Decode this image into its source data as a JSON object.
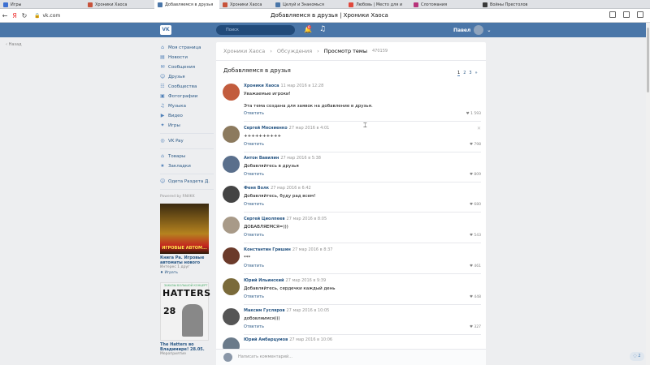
{
  "browser": {
    "tabs": [
      {
        "label": "Игры",
        "color": "#3c6fd1"
      },
      {
        "label": "Хроники Хаоса",
        "color": "#c7533b"
      },
      {
        "label": "Добавляемся в друзья",
        "color": "#4a76a8",
        "active": true
      },
      {
        "label": "Хроники Хаоса",
        "color": "#c7533b"
      },
      {
        "label": "Целуй и Знакомься",
        "color": "#4a76a8"
      },
      {
        "label": "Любовь | Место для и",
        "color": "#e0483c"
      },
      {
        "label": "Слотомания",
        "color": "#b7337a"
      },
      {
        "label": "Войны Престолов",
        "color": "#3a3a3a"
      }
    ],
    "url": "vk.com",
    "page_title": "Добавляемся в друзья | Хроники Хаоса"
  },
  "header": {
    "search_placeholder": "Поиск",
    "notif_count": "6",
    "user_name": "Павел"
  },
  "back_label": "Назад",
  "nav": {
    "items": [
      {
        "label": "Моя страница",
        "icon": "⌂"
      },
      {
        "label": "Новости",
        "icon": "▤"
      },
      {
        "label": "Сообщения",
        "icon": "✉"
      },
      {
        "label": "Друзья",
        "icon": "☺"
      },
      {
        "label": "Сообщества",
        "icon": "☷"
      },
      {
        "label": "Фотографии",
        "icon": "▣"
      },
      {
        "label": "Музыка",
        "icon": "♫"
      },
      {
        "label": "Видео",
        "icon": "▶"
      },
      {
        "label": "Игры",
        "icon": "✦"
      }
    ],
    "items2": [
      {
        "label": "VK Pay",
        "icon": "◎"
      }
    ],
    "items3": [
      {
        "label": "Товары",
        "icon": "⌂"
      },
      {
        "label": "Закладки",
        "icon": "★"
      }
    ],
    "items4": [
      {
        "label": "Одета Раздета Д.",
        "icon": "☺"
      }
    ]
  },
  "ads": {
    "powered": "Powered by RNIIKK",
    "ad1_img_text": "ИГРОВЫЕ АВТОМ...",
    "ad1_title": "Книга Ра. Игровые автоматы нового",
    "ad1_sub": "Интерес 1 друг",
    "ad1_link": "♦ Играть",
    "ad2_top": "ЗАКАЗЫ БОЛЬШОЙ КОНЦЕРТ",
    "ad2_head": "HATTERS",
    "ad2_date": "28",
    "ad2_title": "The Hatters во Владимире! 28.05.",
    "ad2_sub": "Мероприятие"
  },
  "main": {
    "crumbs": [
      "Хроники Хаоса",
      "Обсуждения",
      "Просмотр темы"
    ],
    "crumb_count": "470159",
    "topic_title": "Добавляемся в друзья",
    "pager": [
      "1",
      "2",
      "3",
      "»"
    ],
    "reply_label": "Ответить",
    "composer_placeholder": "Написать комментарий...",
    "posts": [
      {
        "author": "Хроники Хаоса",
        "date": "11 мар 2016 в 12:28",
        "text": "Уважаемые игроки!",
        "text2": "Эта тема создана для заявок на добавление в друзья.",
        "likes": "♥ 1 593",
        "color": "#c25c3d"
      },
      {
        "author": "Сергей Мясниенко",
        "date": "27 мар 2016 в 4:01",
        "text": "++++++++++",
        "likes": "♥ 798",
        "color": "#8c7a5e"
      },
      {
        "author": "Антон Вавилин",
        "date": "27 мар 2016 в 5:38",
        "text": "Добавляйтесь в друзья",
        "likes": "♥ 809",
        "color": "#5a6f8c"
      },
      {
        "author": "Феня Волк",
        "date": "27 мар 2016 в 6:42",
        "text": "Добавляйтесь, буду рад всем!",
        "likes": "♥ 680",
        "color": "#444"
      },
      {
        "author": "Сергей Циолпеев",
        "date": "27 мар 2016 в 8:05",
        "text": "ДОБАВЛЯЕМСЯ=)))",
        "likes": "♥ 543",
        "color": "#a89a88"
      },
      {
        "author": "Константин Гришин",
        "date": "27 мар 2016 в 8:37",
        "text": "***",
        "likes": "♥ 461",
        "color": "#6b3a2a"
      },
      {
        "author": "Юрий Ильинский",
        "date": "27 мар 2016 в 9:39",
        "text": "Добавляйтесь, сердечки каждый день",
        "likes": "♥ 448",
        "color": "#7a6a3a"
      },
      {
        "author": "Максим Гусляров",
        "date": "27 мар 2016 в 10:05",
        "text": "добовляимся)))",
        "likes": "♥ 327",
        "color": "#555"
      },
      {
        "author": "Юрий Амбарцумов",
        "date": "27 мар 2016 в 10:06",
        "text": "",
        "likes": "",
        "color": "#6a7a8a"
      }
    ]
  }
}
